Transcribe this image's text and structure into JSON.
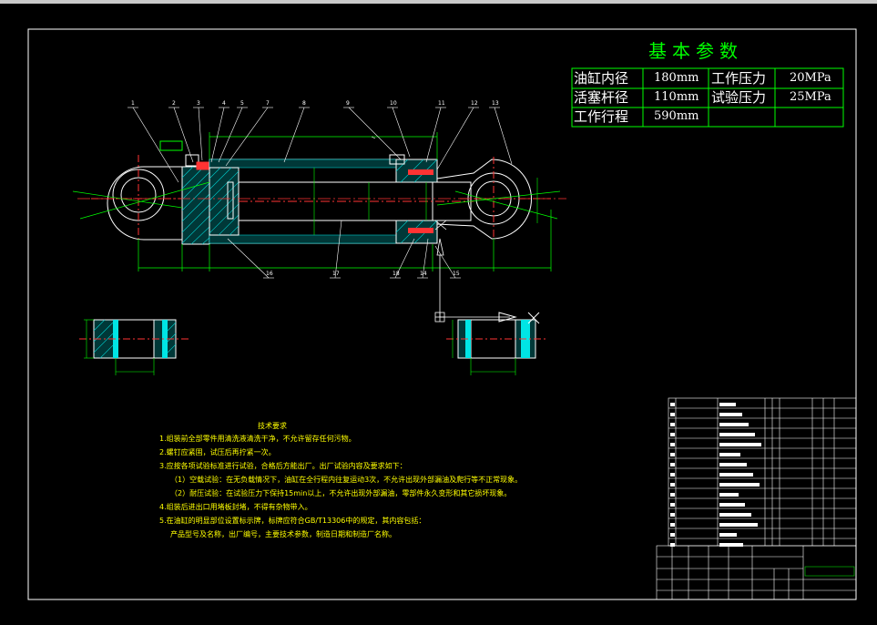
{
  "parameters": {
    "title": "基本参数",
    "rows": [
      {
        "label": "油缸内径",
        "value": "180mm",
        "label2": "工作压力",
        "value2": "20MPa"
      },
      {
        "label": "活塞杆径",
        "value": "110mm",
        "label2": "试验压力",
        "value2": "25MPa"
      },
      {
        "label": "工作行程",
        "value": "590mm",
        "label2": "",
        "value2": ""
      }
    ]
  },
  "tech_requirements": {
    "title": "技术要求",
    "items": [
      "1.组装前全部零件用清洗液清洗干净，不允许留存任何污物。",
      "2.螺钉应紧固，试压后再拧紧一次。",
      "3.应按各项试验标准进行试验，合格后方能出厂。出厂试验内容及要求如下：",
      "（1）空载试验：在无负载情况下，油缸在全行程内往复运动3次，不允许出现外部漏油及爬行等不正常现象。",
      "（2）耐压试验：在试验压力下保持15min以上，不允许出现外部漏油，零部件永久变形和其它损坏现象。",
      "4.组装后进出口用堵板封堵，不得有杂物带入。",
      "5.在油缸的明显部位设置标示牌，标牌应符合GB/T13306中的规定，其内容包括：",
      "产品型号及名称，出厂编号，主要技术参数，制造日期和制造厂名称。"
    ]
  },
  "part_numbers": [
    "1",
    "2",
    "3",
    "4",
    "5",
    "7",
    "8",
    "9",
    "10",
    "11",
    "12",
    "13",
    "16",
    "17",
    "18",
    "14",
    "15",
    "16"
  ],
  "colors": {
    "background": "#000000",
    "frame": "#ffffff",
    "table_lines": "#00ff00",
    "parts": "#ffffff",
    "hatch": "#00cccc",
    "cyan_fill": "#00e5e5",
    "dimension": "#00ff00",
    "centerline": "#ff3333",
    "notes_text": "#ffff00"
  }
}
